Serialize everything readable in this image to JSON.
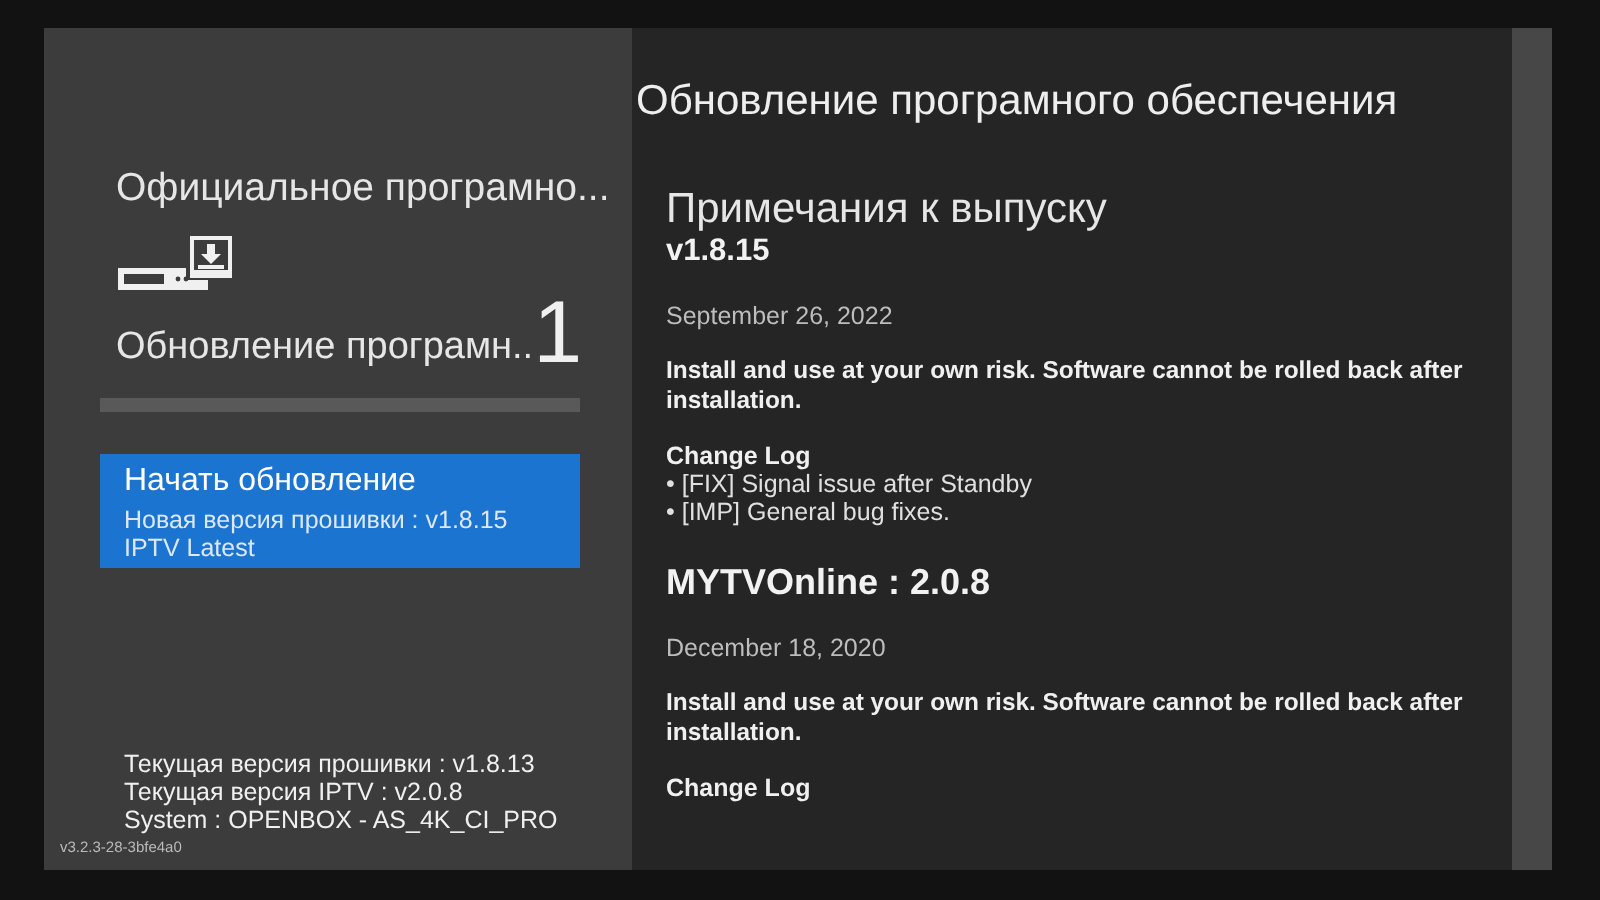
{
  "left": {
    "title": "Официальное програмно...",
    "update": {
      "label": "Обновление програмн..",
      "count": "1"
    },
    "progress": {
      "level": 0
    },
    "action": {
      "title": "Начать обновление",
      "lines": [
        "Новая версия прошивки : v1.8.15",
        "IPTV Latest"
      ],
      "selected": true
    },
    "info": [
      "Текущая версия прошивки : v1.8.13",
      "Текущая версия IPTV : v2.0.8",
      "System : OPENBOX - AS_4K_CI_PRO"
    ],
    "build": "v3.2.3-28-3bfe4a0"
  },
  "right": {
    "title": "Обновление програмного обеспечения",
    "notes": [
      {
        "kind": "firmware",
        "heading": "Примечания к выпуску",
        "version": "v1.8.15",
        "date": "September 26, 2022",
        "warning": "Install and use at your own risk. Software cannot be rolled back after installation.",
        "changelog_title": "Change Log",
        "items": [
          "• [FIX] Signal issue after Standby",
          "• [IMP] General bug fixes."
        ]
      },
      {
        "kind": "app",
        "version": "MYTVOnline : 2.0.8",
        "date": "December 18, 2020",
        "warning": "Install and use at your own risk. Software cannot be rolled back after installation.",
        "changelog_title": "Change Log"
      }
    ]
  }
}
